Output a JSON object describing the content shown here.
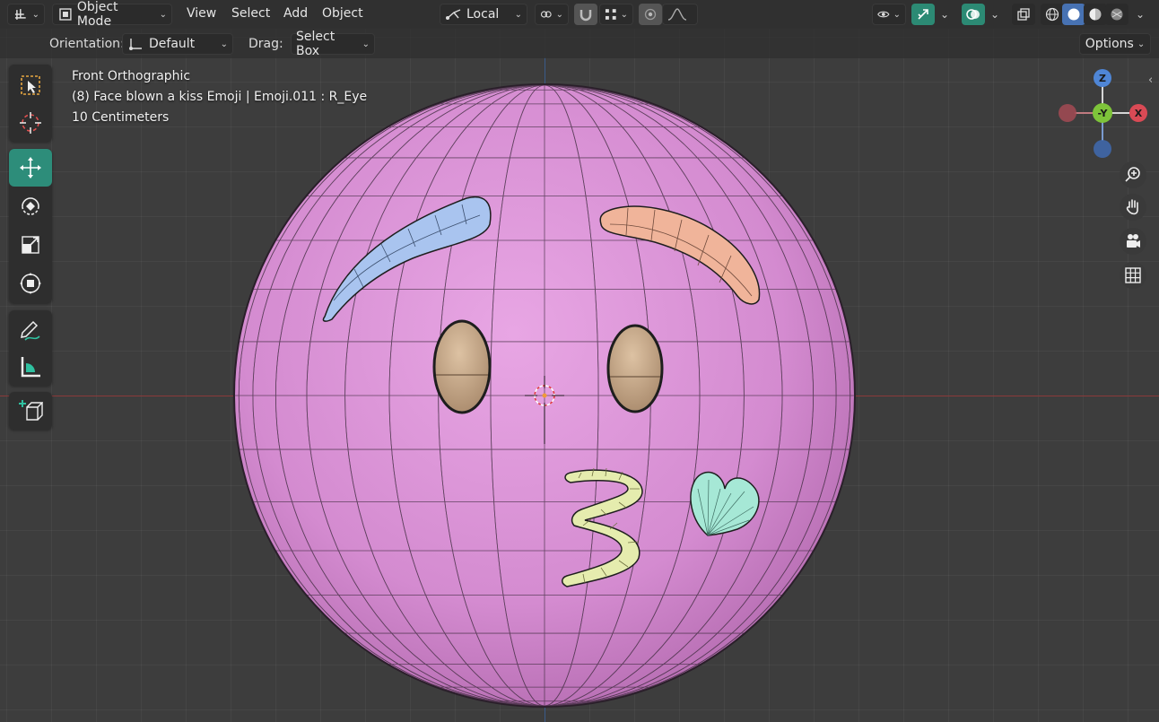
{
  "header": {
    "mode_label": "Object Mode",
    "menus": [
      "View",
      "Select",
      "Add",
      "Object"
    ],
    "transform_orientation": "Local",
    "options_label": "Options"
  },
  "tool_settings": {
    "orientation_label": "Orientation:",
    "orientation_value": "Default",
    "drag_label": "Drag:",
    "drag_value": "Select Box"
  },
  "viewport_info": {
    "view_name": "Front Orthographic",
    "object_info": "(8) Face blown a kiss Emoji | Emoji.011 : R_Eye",
    "scale": "10 Centimeters"
  },
  "gizmo": {
    "z": "Z",
    "y": "-Y",
    "x": "X"
  },
  "colors": {
    "accent_teal": "#2d8d7a",
    "face_pink": "#d88fd4",
    "brow_blue": "#a9c4ef",
    "brow_peach": "#f0b49a",
    "lips_yellow": "#e5ecae",
    "heart_mint": "#a6e8d6",
    "eye_tan": "#c8a98a",
    "gizmo_z": "#4f86d6",
    "gizmo_y": "#7ec43a",
    "gizmo_x": "#d94a55"
  }
}
